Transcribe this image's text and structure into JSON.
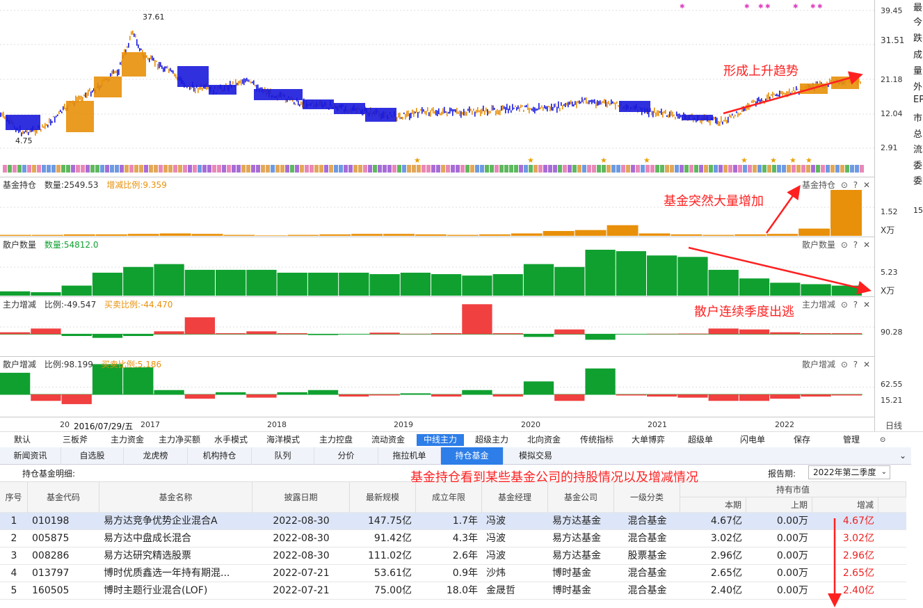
{
  "price_pane": {
    "y_labels": [
      "39.45",
      "31.51",
      "21.18",
      "12.04",
      "2.91"
    ],
    "high_label": "37.61",
    "low_label": "4.75"
  },
  "fund_pane": {
    "title": "基金持仓",
    "count_label": "数量:2549.53",
    "ratio_label": "增减比例:9.359",
    "ctrl": "基金持仓",
    "y_label": "1.52",
    "unit": "X万"
  },
  "retail_pane": {
    "title": "散户数量",
    "count_label": "数量:54812.0",
    "ctrl": "散户数量",
    "y_label": "5.23",
    "unit": "X万"
  },
  "main_pane": {
    "title": "主力增减",
    "ratio_label": "比例:-49.547",
    "buy_label": "买卖比例:-44.470",
    "ctrl": "主力增减",
    "y_label": "90.28"
  },
  "retailchg_pane": {
    "title": "散户增减",
    "ratio_label": "比例:98.199",
    "buy_label": "买卖比例:5.186",
    "ctrl": "散户增减",
    "y_labels": [
      "62.55",
      "15.21"
    ]
  },
  "x_axis": {
    "labels": [
      "20",
      "2016/07/29/五",
      "2017",
      "2018",
      "2019",
      "2020",
      "2021",
      "2022"
    ],
    "right_label": "日线"
  },
  "right_panel": [
    "最",
    "今",
    "跌",
    "成",
    "量",
    "外",
    "EP",
    "市",
    "总",
    "流",
    "委",
    "委",
    "15"
  ],
  "toolbar": [
    "默认",
    "三板斧",
    "主力资金",
    "主力净买额",
    "水手模式",
    "海洋模式",
    "主力控盘",
    "流动资金",
    "中线主力",
    "超级主力",
    "北向资金",
    "传统指标",
    "大单博弈",
    "超级单",
    "闪电单",
    "保存",
    "管理"
  ],
  "tabs": [
    "新闻资讯",
    "自选股",
    "龙虎榜",
    "机构持仓",
    "队列",
    "分价",
    "拖拉机单",
    "持仓基金",
    "模拟交易"
  ],
  "detail": {
    "title": "持仓基金明细:",
    "report_label": "报告期:",
    "report_value": "2022年第二季度"
  },
  "table": {
    "headers": [
      "序号",
      "基金代码",
      "基金名称",
      "披露日期",
      "最新规模",
      "成立年限",
      "基金经理",
      "基金公司",
      "一级分类",
      "持有市值",
      "本期",
      "上期",
      "增减"
    ],
    "rows": [
      [
        "1",
        "010198",
        "易方达竞争优势企业混合A",
        "2022-08-30",
        "147.75亿",
        "1.7年",
        "冯波",
        "易方达基金",
        "混合基金",
        "4.67亿",
        "0.00万",
        "4.67亿"
      ],
      [
        "2",
        "005875",
        "易方达中盘成长混合",
        "2022-08-30",
        "91.42亿",
        "4.3年",
        "冯波",
        "易方达基金",
        "混合基金",
        "3.02亿",
        "0.00万",
        "3.02亿"
      ],
      [
        "3",
        "008286",
        "易方达研究精选股票",
        "2022-08-30",
        "111.02亿",
        "2.6年",
        "冯波",
        "易方达基金",
        "股票基金",
        "2.96亿",
        "0.00万",
        "2.96亿"
      ],
      [
        "4",
        "013797",
        "博时优质鑫选一年持有期混...",
        "2022-07-21",
        "53.61亿",
        "0.9年",
        "沙炜",
        "博时基金",
        "混合基金",
        "2.65亿",
        "0.00万",
        "2.65亿"
      ],
      [
        "5",
        "160505",
        "博时主题行业混合(LOF)",
        "2022-07-21",
        "75.00亿",
        "18.0年",
        "金晟哲",
        "博时基金",
        "混合基金",
        "2.40亿",
        "0.00万",
        "2.40亿"
      ]
    ]
  },
  "annotations": {
    "uptrend": "形成上升趋势",
    "fund_increase": "基金突然大量增加",
    "retail_outflow": "散户连续季度出逃",
    "fund_detail": "基金持仓看到某些基金公司的持股情况以及增减情况"
  },
  "colors": {
    "up": "#e8900a",
    "down": "#1a1adc",
    "green": "#10a030",
    "red": "#f04040",
    "accent": "#2d7ee8",
    "annot": "#ff2020"
  },
  "chart_data": {
    "type": "bar",
    "fund_holdings": [
      0.02,
      0.02,
      0.03,
      0.03,
      0.04,
      0.05,
      0.04,
      0.02,
      0.01,
      0.02,
      0.03,
      0.04,
      0.04,
      0.03,
      0.02,
      0.03,
      0.05,
      0.1,
      0.12,
      0.22,
      0.05,
      0.03,
      0.02,
      0.03,
      0.04,
      0.15,
      0.95
    ],
    "retail_count": [
      0.15,
      0.12,
      0.35,
      0.8,
      1.0,
      1.1,
      0.9,
      0.9,
      0.9,
      0.8,
      0.8,
      0.8,
      0.75,
      0.8,
      0.75,
      0.7,
      0.75,
      1.1,
      1.0,
      1.6,
      1.55,
      1.4,
      1.35,
      0.9,
      0.6,
      0.45,
      0.4,
      0.35
    ],
    "main_change": [
      0.1,
      0.3,
      -0.1,
      -0.2,
      -0.1,
      0.15,
      0.9,
      0.05,
      0.15,
      0.05,
      -0.05,
      0.0,
      0.08,
      0.02,
      0.05,
      1.6,
      0.05,
      -0.15,
      0.25,
      -0.3,
      0.0,
      0.02,
      0.03,
      0.3,
      0.25,
      0.1,
      0.05,
      0.05
    ],
    "retail_change": [
      1.0,
      -0.3,
      -0.45,
      1.4,
      1.25,
      0.2,
      -0.2,
      0.1,
      -0.15,
      0.1,
      0.2,
      -0.1,
      -0.05,
      0.05,
      -0.1,
      0.2,
      -0.1,
      0.6,
      -0.3,
      1.2,
      -0.05,
      -0.1,
      -0.15,
      -0.3,
      -0.3,
      -0.2,
      -0.1,
      -0.05
    ]
  }
}
